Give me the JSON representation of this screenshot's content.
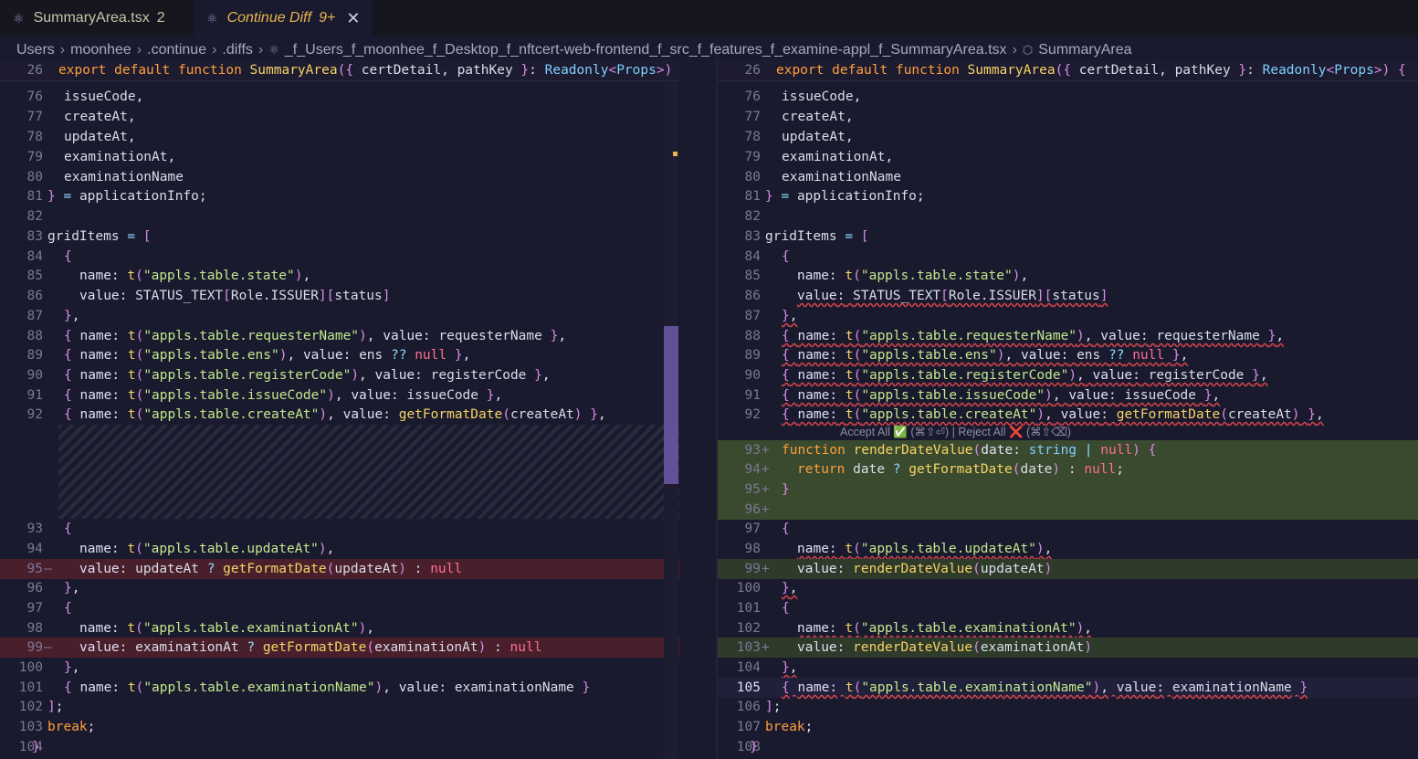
{
  "tabs": [
    {
      "label": "SummaryArea.tsx",
      "badge": "2"
    },
    {
      "label": "Continue Diff",
      "badge": "9+"
    }
  ],
  "breadcrumb": [
    "Users",
    "moonhee",
    ".continue",
    ".diffs",
    "_f_Users_f_moonhee_f_Desktop_f_nftcert-web-frontend_f_src_f_features_f_examine-appl_f_SummaryArea.tsx",
    "SummaryArea"
  ],
  "codelens": {
    "accept": "Accept All ✅ (⌘⇧⏎)",
    "separator": " | ",
    "reject": "Reject All ❌ (⌘⇧⌫)"
  },
  "left_pane": {
    "sticky": {
      "ln": "26",
      "text": "export default function SummaryArea({ certDetail, pathKey }: Readonly<Props>)"
    },
    "lines": [
      {
        "ln": "76",
        "text": "issueCode,"
      },
      {
        "ln": "77",
        "text": "createAt,"
      },
      {
        "ln": "78",
        "text": "updateAt,"
      },
      {
        "ln": "79",
        "text": "examinationAt,"
      },
      {
        "ln": "80",
        "text": "examinationName"
      },
      {
        "ln": "81",
        "text": "} = applicationInfo;"
      },
      {
        "ln": "82",
        "text": ""
      },
      {
        "ln": "83",
        "text": "gridItems = ["
      },
      {
        "ln": "84",
        "text": "{"
      },
      {
        "ln": "85",
        "text": "name: t(\"appls.table.state\"),"
      },
      {
        "ln": "86",
        "text": "value: STATUS_TEXT[Role.ISSUER][status]"
      },
      {
        "ln": "87",
        "text": "},"
      },
      {
        "ln": "88",
        "text": "{ name: t(\"appls.table.requesterName\"), value: requesterName },"
      },
      {
        "ln": "89",
        "text": "{ name: t(\"appls.table.ens\"), value: ens ?? null },"
      },
      {
        "ln": "90",
        "text": "{ name: t(\"appls.table.registerCode\"), value: registerCode },"
      },
      {
        "ln": "91",
        "text": "{ name: t(\"appls.table.issueCode\"), value: issueCode },"
      },
      {
        "ln": "92",
        "text": "{ name: t(\"appls.table.createAt\"), value: getFormatDate(createAt) },"
      },
      {
        "ln": "93",
        "text": "{"
      },
      {
        "ln": "94",
        "text": "name: t(\"appls.table.updateAt\"),"
      },
      {
        "ln": "95",
        "mark": "—",
        "text": "value: updateAt ? getFormatDate(updateAt) : null"
      },
      {
        "ln": "96",
        "text": "},"
      },
      {
        "ln": "97",
        "text": "{"
      },
      {
        "ln": "98",
        "text": "name: t(\"appls.table.examinationAt\"),"
      },
      {
        "ln": "99",
        "mark": "—",
        "text": "value: examinationAt ? getFormatDate(examinationAt) : null"
      },
      {
        "ln": "100",
        "text": "},"
      },
      {
        "ln": "101",
        "text": "{ name: t(\"appls.table.examinationName\"), value: examinationName }"
      },
      {
        "ln": "102",
        "text": "];"
      },
      {
        "ln": "103",
        "text": "break;"
      },
      {
        "ln": "104",
        "text": "}"
      }
    ]
  },
  "right_pane": {
    "sticky": {
      "ln": "26",
      "text": "export default function SummaryArea({ certDetail, pathKey }: Readonly<Props>) {"
    },
    "lines": [
      {
        "ln": "76",
        "text": "issueCode,"
      },
      {
        "ln": "77",
        "text": "createAt,"
      },
      {
        "ln": "78",
        "text": "updateAt,"
      },
      {
        "ln": "79",
        "text": "examinationAt,"
      },
      {
        "ln": "80",
        "text": "examinationName"
      },
      {
        "ln": "81",
        "text": "} = applicationInfo;"
      },
      {
        "ln": "82",
        "text": ""
      },
      {
        "ln": "83",
        "text": "gridItems = ["
      },
      {
        "ln": "84",
        "text": "{"
      },
      {
        "ln": "85",
        "text": "name: t(\"appls.table.state\"),"
      },
      {
        "ln": "86",
        "text": "value: STATUS_TEXT[Role.ISSUER][status]"
      },
      {
        "ln": "87",
        "text": "},"
      },
      {
        "ln": "88",
        "text": "{ name: t(\"appls.table.requesterName\"), value: requesterName },"
      },
      {
        "ln": "89",
        "text": "{ name: t(\"appls.table.ens\"), value: ens ?? null },"
      },
      {
        "ln": "90",
        "text": "{ name: t(\"appls.table.registerCode\"), value: registerCode },"
      },
      {
        "ln": "91",
        "text": "{ name: t(\"appls.table.issueCode\"), value: issueCode },"
      },
      {
        "ln": "92",
        "text": "{ name: t(\"appls.table.createAt\"), value: getFormatDate(createAt) },"
      },
      {
        "ln": "93",
        "mark": "+",
        "text": "function renderDateValue(date: string | null) {"
      },
      {
        "ln": "94",
        "mark": "+",
        "text": "return date ? getFormatDate(date) : null;"
      },
      {
        "ln": "95",
        "mark": "+",
        "text": "}"
      },
      {
        "ln": "96",
        "mark": "+",
        "text": ""
      },
      {
        "ln": "97",
        "text": "{"
      },
      {
        "ln": "98",
        "text": "name: t(\"appls.table.updateAt\"),"
      },
      {
        "ln": "99",
        "mark": "+",
        "text": "value: renderDateValue(updateAt)"
      },
      {
        "ln": "100",
        "text": "},"
      },
      {
        "ln": "101",
        "text": "{"
      },
      {
        "ln": "102",
        "text": "name: t(\"appls.table.examinationAt\"),"
      },
      {
        "ln": "103",
        "mark": "+",
        "text": "value: renderDateValue(examinationAt)"
      },
      {
        "ln": "104",
        "text": "},"
      },
      {
        "ln": "105",
        "text": "{ name: t(\"appls.table.examinationName\"), value: examinationName }"
      },
      {
        "ln": "106",
        "text": "];"
      },
      {
        "ln": "107",
        "text": "break;"
      },
      {
        "ln": "108",
        "text": "}"
      }
    ]
  },
  "colors": {
    "background": "#1a1a2e",
    "deleted": "#4a1f2c",
    "added": "#3a4a2f",
    "accent": "#e6b450"
  }
}
